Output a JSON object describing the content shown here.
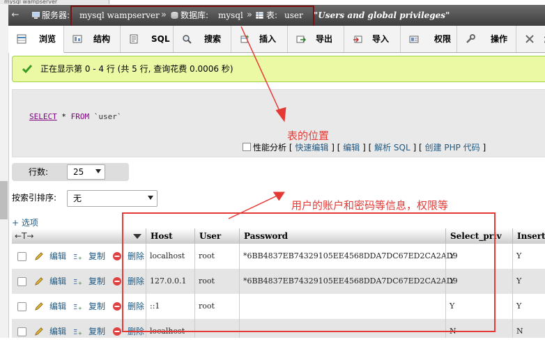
{
  "browser": {
    "tab_title": "mysql wampserver"
  },
  "breadcrumb": {
    "server_label": "服务器:",
    "server_value": "mysql wampserver",
    "database_label": "数据库:",
    "database_value": "mysql",
    "table_label": "表:",
    "table_value": "user",
    "comment": "\"Users and global privileges\"",
    "separator": "»"
  },
  "tabs": [
    {
      "label": "浏览",
      "icon": "browse-icon"
    },
    {
      "label": "结构",
      "icon": "structure-icon"
    },
    {
      "label": "SQL",
      "icon": "sql-icon"
    },
    {
      "label": "搜索",
      "icon": "search-icon"
    },
    {
      "label": "插入",
      "icon": "insert-icon"
    },
    {
      "label": "导出",
      "icon": "export-icon"
    },
    {
      "label": "导入",
      "icon": "import-icon"
    },
    {
      "label": "权限",
      "icon": "privileges-icon"
    },
    {
      "label": "操作",
      "icon": "operations-icon"
    },
    {
      "label": "触",
      "icon": "triggers-icon"
    }
  ],
  "message": {
    "text": "正在显示第 0 - 4 行 (共 5 行, 查询花费 0.0006 秒)"
  },
  "sql": {
    "select": "SELECT",
    "star": " * ",
    "from": "FROM",
    "rest": " `user`",
    "profile_label": "性能分析",
    "links": {
      "open": "[",
      "close": "]",
      "inline_edit": "快速编辑",
      "edit": "编辑",
      "explain": "解析 SQL",
      "create_php": "创建 PHP 代码"
    }
  },
  "navigation": {
    "rows_label": "行数:",
    "rows_value": "25",
    "sort_label": "按索引排序:",
    "sort_value": "无",
    "options_label": "+ 选项",
    "arrows": "←T→"
  },
  "table": {
    "columns": [
      "Host",
      "User",
      "Password",
      "Select_priv",
      "Insert"
    ],
    "actions": {
      "edit": "编辑",
      "copy": "复制",
      "delete": "删除"
    },
    "rows": [
      {
        "host": "localhost",
        "user": "root",
        "password": "*6BB4837EB74329105EE4568DDA7DC67ED2CA2AD9",
        "select_priv": "Y",
        "insert_priv": "Y"
      },
      {
        "host": "127.0.0.1",
        "user": "root",
        "password": "*6BB4837EB74329105EE4568DDA7DC67ED2CA2AD9",
        "select_priv": "Y",
        "insert_priv": "Y"
      },
      {
        "host": "::1",
        "user": "root",
        "password": "",
        "select_priv": "Y",
        "insert_priv": "Y"
      },
      {
        "host": "localhost",
        "user": "",
        "password": "",
        "select_priv": "N",
        "insert_priv": "N"
      }
    ]
  },
  "annotations": {
    "table_location": "表的位置",
    "user_info": "用户的账户和密码等信息，权限等"
  },
  "colors": {
    "annotation_red": "#e53935",
    "link_blue": "#235a81",
    "success_bg": "#ebf8a4"
  }
}
